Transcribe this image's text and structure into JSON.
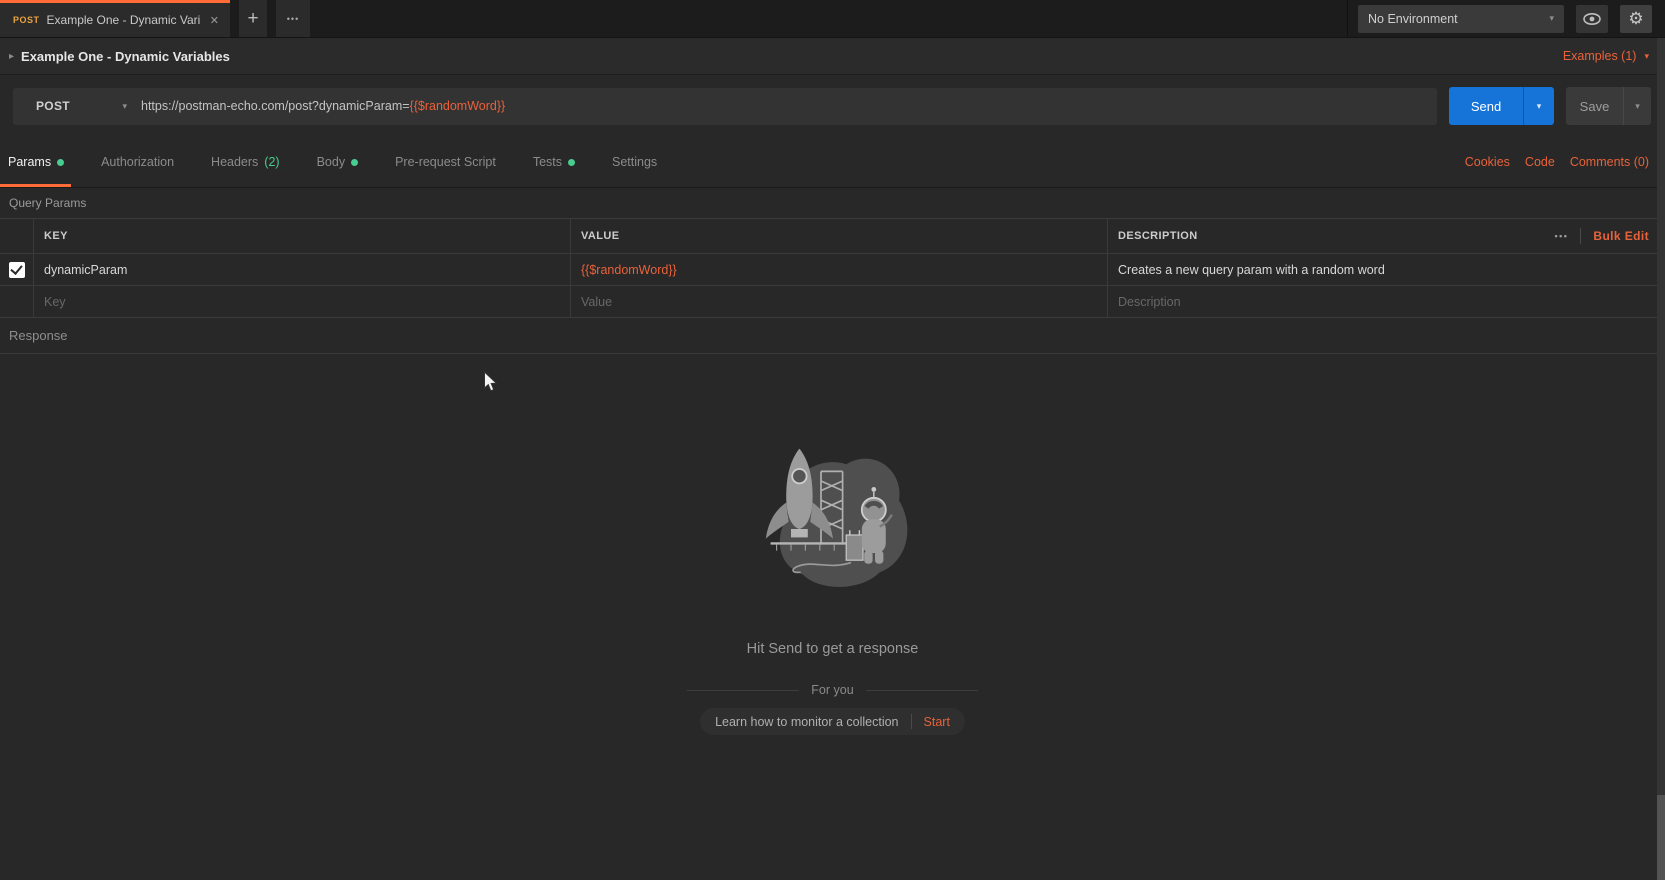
{
  "window": {
    "tab": {
      "method_badge": "POST",
      "title": "Example One - Dynamic Varia..."
    },
    "environment": {
      "selected": "No Environment"
    }
  },
  "icons": {
    "close": "✕",
    "plus": "+",
    "more_h": "•••",
    "chevron_down": "▾",
    "caret_right": "▸",
    "gear": "⚙"
  },
  "request": {
    "title": "Example One - Dynamic Variables",
    "examples": "Examples (1)",
    "method": "POST",
    "url_base": "https://postman-echo.com/post?dynamicParam=",
    "url_variable": "{{$randomWord}}",
    "send": "Send",
    "save": "Save"
  },
  "tabs": [
    {
      "label": "Params",
      "active": true,
      "dot": true
    },
    {
      "label": "Authorization"
    },
    {
      "label": "Headers",
      "count": "(2)"
    },
    {
      "label": "Body",
      "dot": true
    },
    {
      "label": "Pre-request Script"
    },
    {
      "label": "Tests",
      "dot": true
    },
    {
      "label": "Settings"
    }
  ],
  "quick_links": {
    "cookies": "Cookies",
    "code": "Code",
    "comments": "Comments (0)"
  },
  "query_params": {
    "section_label": "Query Params",
    "columns": {
      "key": "KEY",
      "value": "VALUE",
      "description": "DESCRIPTION"
    },
    "bulk_edit": "Bulk Edit",
    "rows": [
      {
        "checked": true,
        "key": "dynamicParam",
        "value": "{{$randomWord}}",
        "description": "Creates a new query param with a random word"
      }
    ],
    "new_row_placeholders": {
      "key": "Key",
      "value": "Value",
      "description": "Description"
    }
  },
  "response": {
    "section_label": "Response",
    "empty_state": {
      "title": "Hit Send to get a response",
      "divider_label": "For you",
      "cta_label": "Learn how to monitor a collection",
      "cta_action": "Start"
    }
  },
  "colors": {
    "accent_orange": "#ff6c37",
    "link_orange": "#e8623a",
    "send_blue": "#1673d8",
    "success_green": "#49cc90",
    "method_badge_amber": "#e8a33d"
  }
}
